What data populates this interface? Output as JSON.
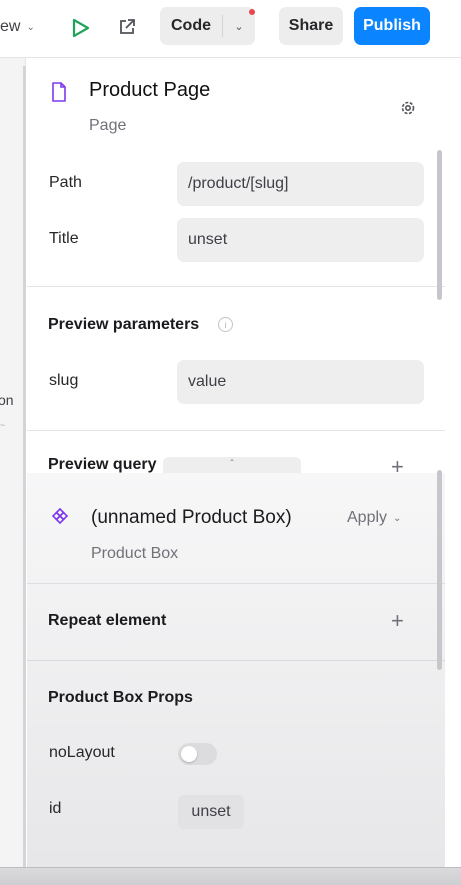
{
  "toolbar": {
    "view_fragment": "ew",
    "code_label": "Code",
    "share_label": "Share",
    "publish_label": "Publish",
    "colors": {
      "publish_bg": "#0a84ff",
      "play": "#22a35a",
      "notification_dot": "#e5484d"
    }
  },
  "canvas": {
    "text_fragment": "on",
    "small_fragment": "~"
  },
  "page": {
    "title": "Product Page",
    "type_label": "Page",
    "icon": "document-icon",
    "settings_icon": "gear-icon",
    "path_label": "Path",
    "path_value": "/product/[slug]",
    "title_label": "Title",
    "title_value": "unset"
  },
  "preview_parameters": {
    "heading": "Preview parameters",
    "info_icon": "info-icon",
    "param_label": "slug",
    "param_value": "value"
  },
  "preview_query": {
    "heading": "Preview query",
    "add_icon": "plus-icon"
  },
  "component": {
    "name": "(unnamed Product Box)",
    "type_label": "Product Box",
    "apply_label": "Apply",
    "icon": "component-icon"
  },
  "repeat": {
    "heading": "Repeat element",
    "add_icon": "plus-icon"
  },
  "props": {
    "heading": "Product Box Props",
    "nolayout_label": "noLayout",
    "nolayout_on": false,
    "id_label": "id",
    "id_value": "unset"
  }
}
